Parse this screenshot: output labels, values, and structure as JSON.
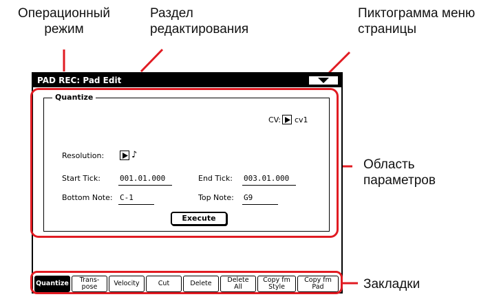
{
  "callouts": {
    "mode": "Операционный\nрежим",
    "section": "Раздел\nредактирования",
    "menu_icon": "Пиктограмма меню\nстраницы",
    "params": "Область\nпараметров",
    "tabs": "Закладки"
  },
  "screen": {
    "title": "PAD REC: Pad Edit",
    "panel_title": "Quantize",
    "cv_label": "CV:",
    "cv_value": "cv1",
    "resolution_label": "Resolution:",
    "resolution_value": "♪",
    "start_tick_label": "Start Tick:",
    "start_tick_value": "001.01.000",
    "end_tick_label": "End Tick:",
    "end_tick_value": "003.01.000",
    "bottom_note_label": "Bottom Note:",
    "bottom_note_value": "C-1",
    "top_note_label": "Top Note:",
    "top_note_value": "G9",
    "execute_label": "Execute",
    "tabs": [
      "Quantize",
      "Trans-\npose",
      "Velocity",
      "Cut",
      "Delete",
      "Delete\nAll",
      "Copy fm\nStyle",
      "Copy fm\nPad"
    ]
  },
  "colors": {
    "highlight": "#e11b22",
    "lcd_bg": "#ffffff",
    "lcd_fg": "#000000"
  },
  "icons": {
    "menu": "triangle-down-icon",
    "popup": "triangle-right-icon",
    "note": "eighth-note-icon"
  }
}
